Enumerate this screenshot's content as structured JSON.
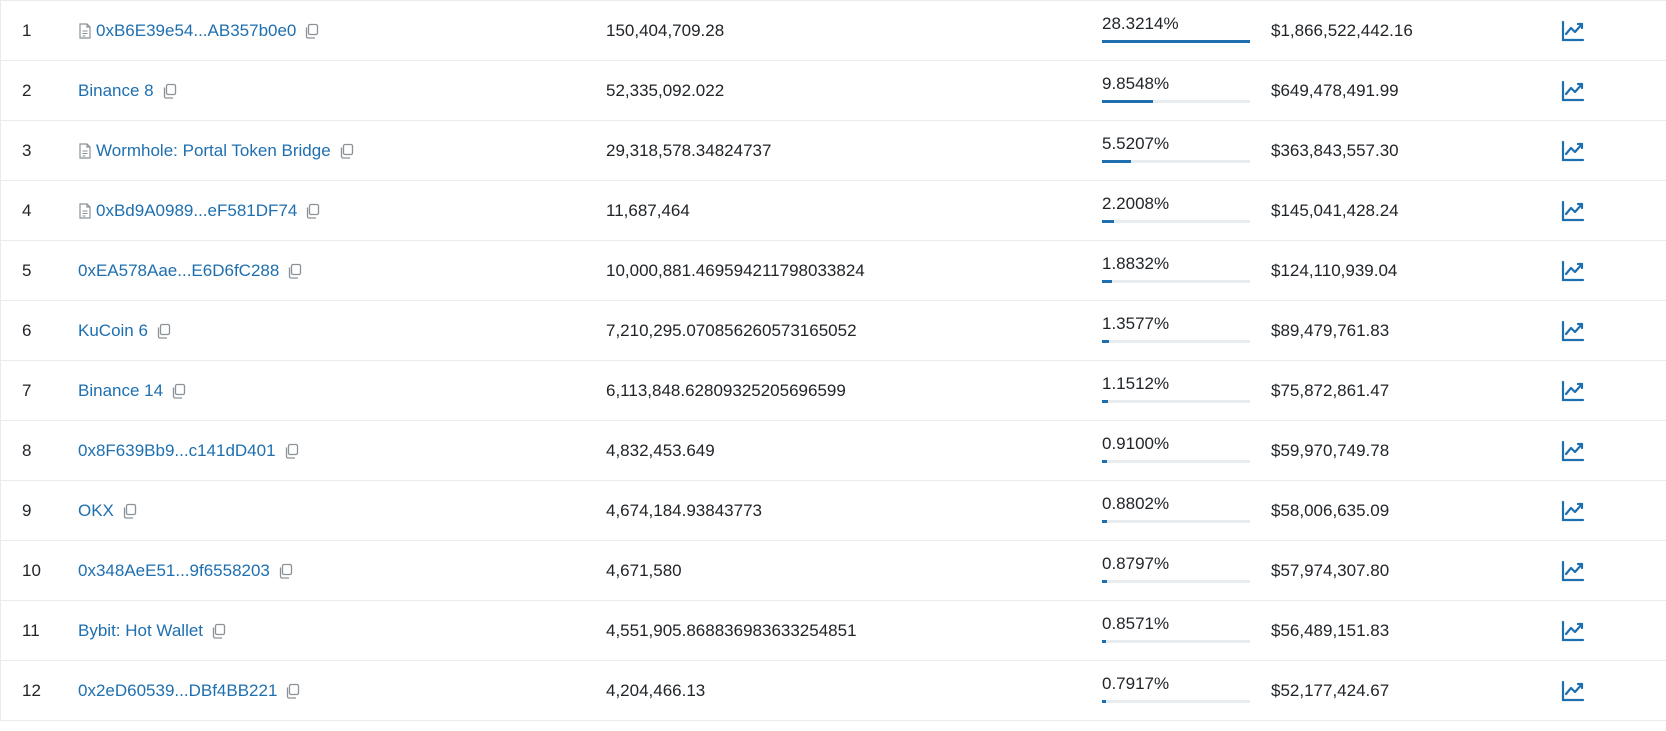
{
  "colors": {
    "link": "#1e6fb0",
    "bar_fill": "#1e6fb0",
    "bar_track": "#e9ecef",
    "text": "#212529"
  },
  "holders": [
    {
      "rank": "1",
      "address": "0xB6E39e54...AB357b0e0",
      "is_contract": true,
      "quantity": "150,404,709.28",
      "percentage": "28.3214%",
      "pct_value": 28.3214,
      "value": "$1,866,522,442.16"
    },
    {
      "rank": "2",
      "address": "Binance 8",
      "is_contract": false,
      "quantity": "52,335,092.022",
      "percentage": "9.8548%",
      "pct_value": 9.8548,
      "value": "$649,478,491.99"
    },
    {
      "rank": "3",
      "address": "Wormhole: Portal Token Bridge",
      "is_contract": true,
      "quantity": "29,318,578.34824737",
      "percentage": "5.5207%",
      "pct_value": 5.5207,
      "value": "$363,843,557.30"
    },
    {
      "rank": "4",
      "address": "0xBd9A0989...eF581DF74",
      "is_contract": true,
      "quantity": "11,687,464",
      "percentage": "2.2008%",
      "pct_value": 2.2008,
      "value": "$145,041,428.24"
    },
    {
      "rank": "5",
      "address": "0xEA578Aae...E6D6fC288",
      "is_contract": false,
      "quantity": "10,000,881.469594211798033824",
      "percentage": "1.8832%",
      "pct_value": 1.8832,
      "value": "$124,110,939.04"
    },
    {
      "rank": "6",
      "address": "KuCoin 6",
      "is_contract": false,
      "quantity": "7,210,295.070856260573165052",
      "percentage": "1.3577%",
      "pct_value": 1.3577,
      "value": "$89,479,761.83"
    },
    {
      "rank": "7",
      "address": "Binance 14",
      "is_contract": false,
      "quantity": "6,113,848.62809325205696599",
      "percentage": "1.1512%",
      "pct_value": 1.1512,
      "value": "$75,872,861.47"
    },
    {
      "rank": "8",
      "address": "0x8F639Bb9...c141dD401",
      "is_contract": false,
      "quantity": "4,832,453.649",
      "percentage": "0.9100%",
      "pct_value": 0.91,
      "value": "$59,970,749.78"
    },
    {
      "rank": "9",
      "address": "OKX",
      "is_contract": false,
      "quantity": "4,674,184.93843773",
      "percentage": "0.8802%",
      "pct_value": 0.8802,
      "value": "$58,006,635.09"
    },
    {
      "rank": "10",
      "address": "0x348AeE51...9f6558203",
      "is_contract": false,
      "quantity": "4,671,580",
      "percentage": "0.8797%",
      "pct_value": 0.8797,
      "value": "$57,974,307.80"
    },
    {
      "rank": "11",
      "address": "Bybit: Hot Wallet",
      "is_contract": false,
      "quantity": "4,551,905.868836983633254851",
      "percentage": "0.8571%",
      "pct_value": 0.8571,
      "value": "$56,489,151.83"
    },
    {
      "rank": "12",
      "address": "0x2eD60539...DBf4BB221",
      "is_contract": false,
      "quantity": "4,204,466.13",
      "percentage": "0.7917%",
      "pct_value": 0.7917,
      "value": "$52,177,424.67"
    }
  ],
  "icons": {
    "contract": "document-icon",
    "copy": "copy-icon",
    "analytics": "chart-line-icon"
  }
}
